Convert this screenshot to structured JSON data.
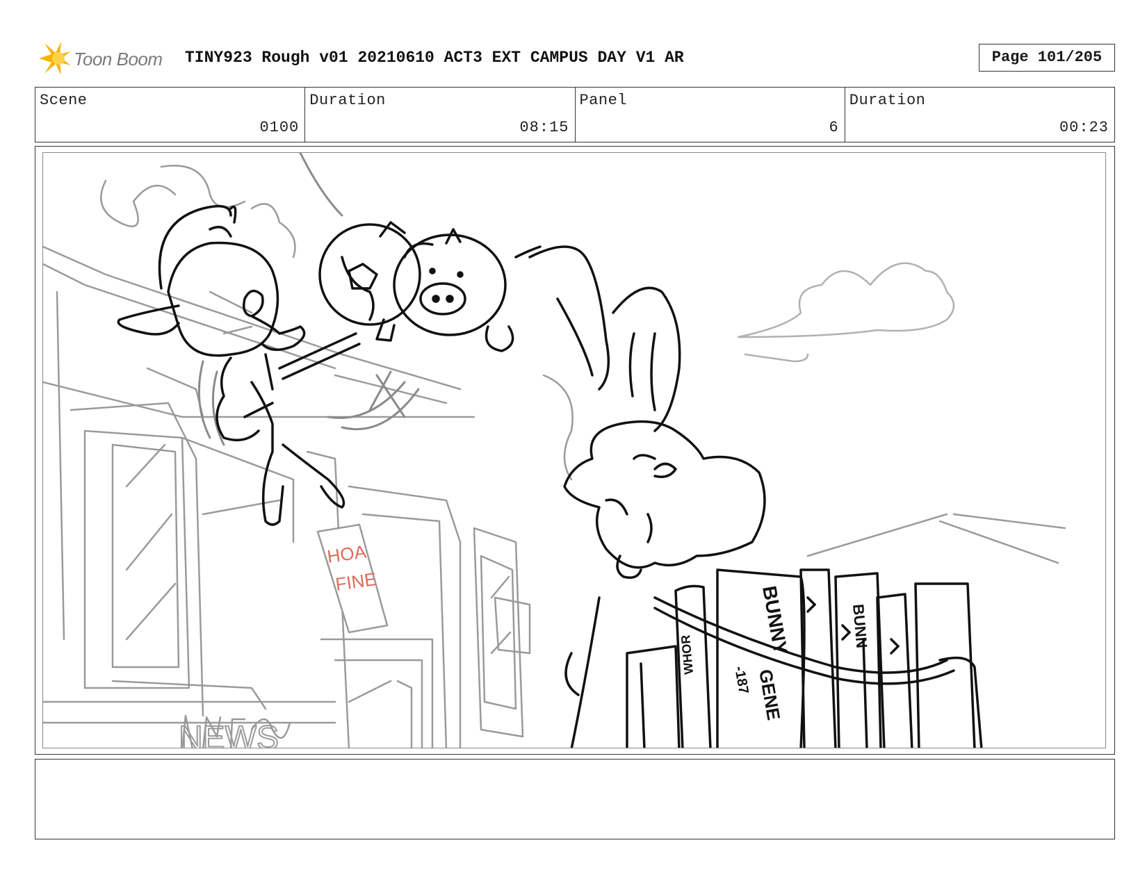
{
  "header": {
    "logo_text": "Toon Boom",
    "title": "TINY923 Rough v01 20210610 ACT3 EXT CAMPUS DAY V1 AR",
    "page_label": "Page 101/205"
  },
  "info": {
    "scene_label": "Scene",
    "scene_value": "0100",
    "duration_label": "Duration",
    "duration_value": "08:15",
    "panel_label": "Panel",
    "panel_value": "6",
    "panel_duration_label": "Duration",
    "panel_duration_value": "00:23"
  },
  "sketch": {
    "sign_text_line1": "HOA",
    "sign_text_line2": "FINE",
    "news_sign_text": "NEWS",
    "book_spine_1": "BUNNY",
    "book_spine_2": "GENE",
    "book_spine_3": "BUNN",
    "book_spine_4": "-187",
    "book_spine_5": "WHOR",
    "accent_color": "#e06a5a"
  },
  "notes": {
    "text": ""
  }
}
